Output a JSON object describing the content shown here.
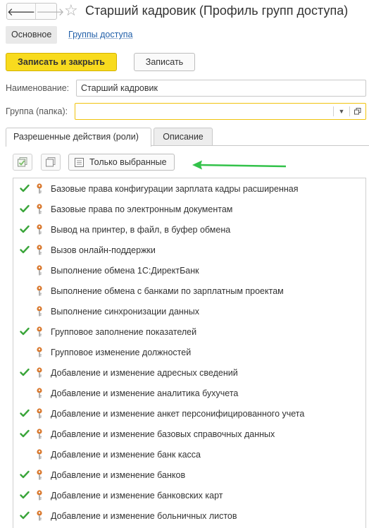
{
  "window": {
    "back_glyph": "🡐",
    "forward_glyph": "🡒",
    "star_glyph": "☆",
    "title": "Старший кадровик (Профиль групп доступа)"
  },
  "nav": {
    "main_tab": "Основное",
    "link_tab": "Группы доступа"
  },
  "commands": {
    "save_close": "Записать и закрыть",
    "save": "Записать"
  },
  "form": {
    "name_label": "Наименование:",
    "name_value": "Старший кадровик",
    "group_label": "Группа (папка):",
    "group_value": ""
  },
  "tabs": {
    "roles": "Разрешенные действия (роли)",
    "description": "Описание"
  },
  "toolbar": {
    "only_selected": "Только выбранные"
  },
  "colors": {
    "accent_yellow": "#f8db1e",
    "check_green": "#3aa53a",
    "key_orange": "#d9782d",
    "arrow_green": "#33c24a",
    "link_blue": "#1f5ea8"
  },
  "roles": [
    {
      "label": "Базовые права конфигурации зарплата кадры расширенная",
      "checked": true
    },
    {
      "label": "Базовые права по электронным документам",
      "checked": true
    },
    {
      "label": "Вывод на принтер, в файл, в буфер обмена",
      "checked": true
    },
    {
      "label": "Вызов онлайн-поддержки",
      "checked": true
    },
    {
      "label": "Выполнение обмена 1С:ДиректБанк",
      "checked": false
    },
    {
      "label": "Выполнение обмена с банками по зарплатным проектам",
      "checked": false
    },
    {
      "label": "Выполнение синхронизации данных",
      "checked": false
    },
    {
      "label": "Групповое заполнение показателей",
      "checked": true
    },
    {
      "label": "Групповое изменение должностей",
      "checked": false
    },
    {
      "label": "Добавление и изменение адресных сведений",
      "checked": true
    },
    {
      "label": "Добавление и изменение аналитика бухучета",
      "checked": false
    },
    {
      "label": "Добавление и изменение анкет персонифицированного учета",
      "checked": true
    },
    {
      "label": "Добавление и изменение базовых справочных данных",
      "checked": true
    },
    {
      "label": "Добавление и изменение банк касса",
      "checked": false
    },
    {
      "label": "Добавление и изменение банков",
      "checked": true
    },
    {
      "label": "Добавление и изменение банковских карт",
      "checked": true
    },
    {
      "label": "Добавление и изменение больничных листов",
      "checked": true
    }
  ]
}
